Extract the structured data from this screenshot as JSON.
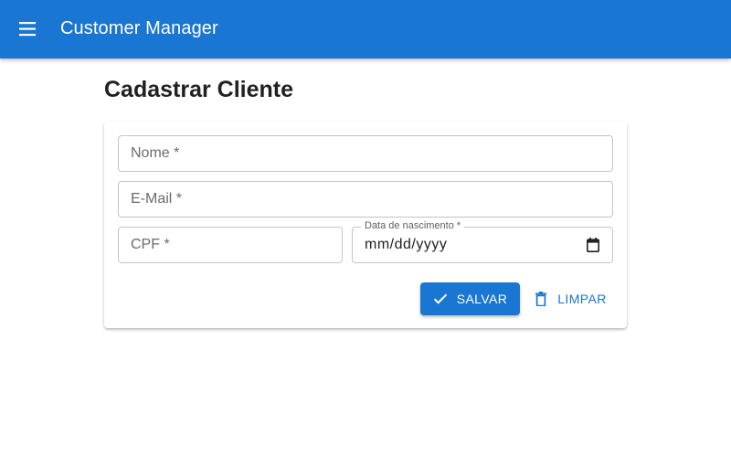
{
  "appbar": {
    "menu_icon": "menu-icon",
    "title": "Customer Manager"
  },
  "page": {
    "title": "Cadastrar Cliente"
  },
  "form": {
    "nome": {
      "placeholder": "Nome *",
      "value": ""
    },
    "email": {
      "placeholder": "E-Mail *",
      "value": ""
    },
    "cpf": {
      "placeholder": "CPF *",
      "value": ""
    },
    "data_nascimento": {
      "label": "Data de nascimento *",
      "value_display": "mm/dd/yyyy",
      "icon": "calendar-icon"
    },
    "salvar_label": "SALVAR",
    "salvar_icon": "check-icon",
    "limpar_label": "LIMPAR",
    "limpar_icon": "trash-icon"
  },
  "colors": {
    "primary": "#1976d2",
    "border": "#c4c4c4"
  }
}
